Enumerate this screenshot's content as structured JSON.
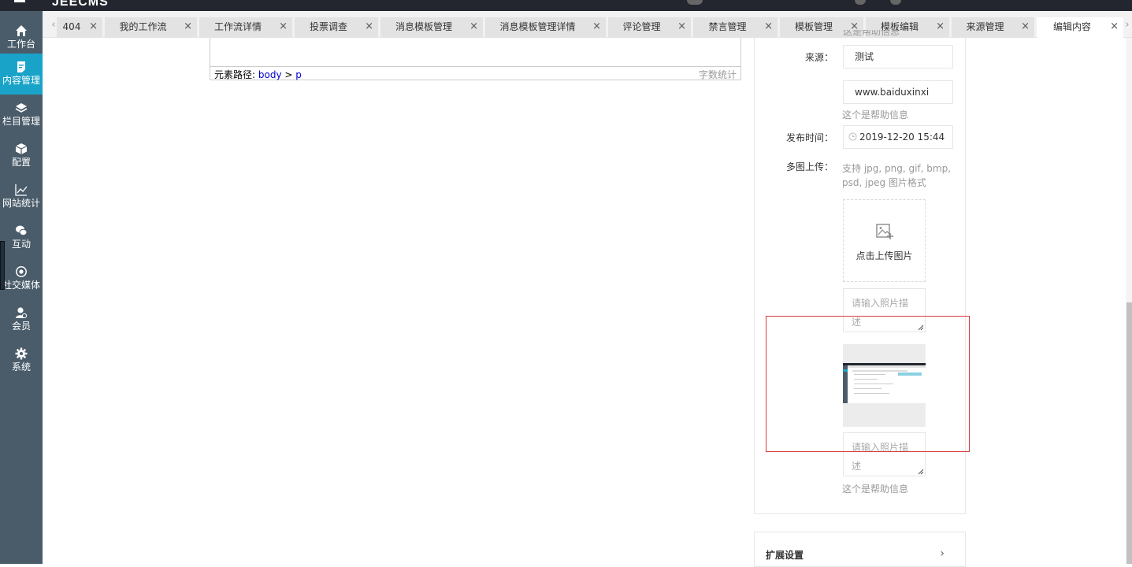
{
  "app": {
    "logo": "JEECMS"
  },
  "sidebar": {
    "items": [
      {
        "label": "工作台",
        "icon": "home-icon"
      },
      {
        "label": "内容管理",
        "icon": "document-icon",
        "active": true
      },
      {
        "label": "栏目管理",
        "icon": "layers-icon"
      },
      {
        "label": "配置",
        "icon": "cube-icon"
      },
      {
        "label": "网站统计",
        "icon": "line-chart-icon"
      },
      {
        "label": "互动",
        "icon": "chat-icon"
      },
      {
        "label": "社交媒体",
        "icon": "target-icon"
      },
      {
        "label": "会员",
        "icon": "user-icon"
      },
      {
        "label": "系统",
        "icon": "gear-icon"
      }
    ]
  },
  "tabs": [
    {
      "label": "404"
    },
    {
      "label": "我的工作流"
    },
    {
      "label": "工作流详情"
    },
    {
      "label": "投票调查"
    },
    {
      "label": "消息模板管理"
    },
    {
      "label": "消息模板管理详情"
    },
    {
      "label": "评论管理"
    },
    {
      "label": "禁言管理"
    },
    {
      "label": "模板管理"
    },
    {
      "label": "模板编辑"
    },
    {
      "label": "来源管理"
    },
    {
      "label": "编辑内容",
      "active": true
    }
  ],
  "editor": {
    "path_label": "元素路径:",
    "path_body": "body",
    "path_sep": ">",
    "path_p": "p",
    "word_count": "字数统计"
  },
  "form": {
    "cut_help": "这是帮助信息",
    "source_label": "来源：",
    "source_value": "测试",
    "source_url": "www.baiduxinxi",
    "source_help": "这个是帮助信息",
    "publish_label": "发布时间：",
    "publish_value": "2019-12-20 15:44",
    "multi_upload_label": "多图上传：",
    "multi_upload_hint_1": "支持 jpg, png, gif, bmp,",
    "multi_upload_hint_2": "psd, jpeg 图片格式",
    "upload_text": "点击上传图片",
    "photo_desc_placeholder_1": "请输入照片描",
    "photo_desc_placeholder_2": "述",
    "photo_desc2_placeholder_1": "请输入照片描",
    "photo_desc2_placeholder_2": "述",
    "upload_help": "这个是帮助信息"
  },
  "extend": {
    "title": "扩展设置"
  },
  "colors": {
    "accent": "#1aa3c8",
    "sidebar": "#4a5c6a",
    "highlight": "#d9383a"
  }
}
